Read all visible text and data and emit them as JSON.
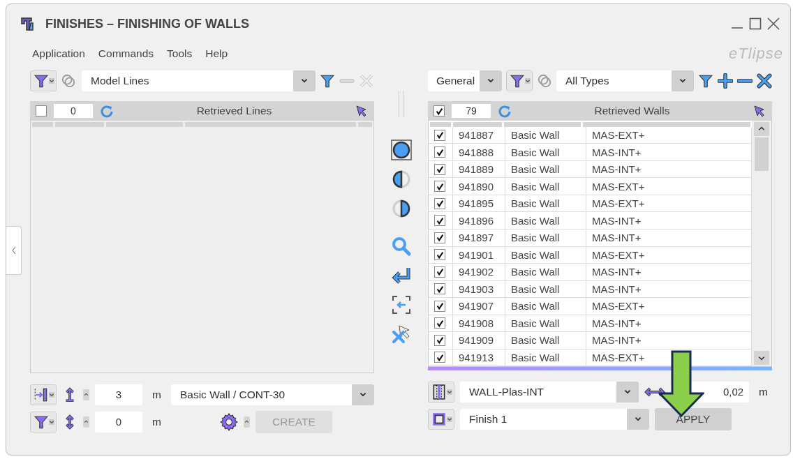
{
  "window": {
    "title": "FINISHES – FINISHING OF WALLS",
    "brand": "eTlipse"
  },
  "menu": [
    "Application",
    "Commands",
    "Tools",
    "Help"
  ],
  "left_panel": {
    "filter": "Model Lines",
    "grid": {
      "all_checked": false,
      "count": "0",
      "title": "Retrieved Lines"
    },
    "height": {
      "value": "3",
      "unit": "m"
    },
    "wall_type": "Basic Wall / CONT-30",
    "offset": {
      "value": "0",
      "unit": "m"
    },
    "create": {
      "label": "CREATE",
      "disabled": true
    }
  },
  "right_panel": {
    "category": "General",
    "filter": "All Types",
    "grid": {
      "all_checked": true,
      "count": "79",
      "title": "Retrieved Walls",
      "rows": [
        {
          "checked": true,
          "id": "941887",
          "family": "Basic Wall",
          "type": "MAS-EXT+"
        },
        {
          "checked": true,
          "id": "941888",
          "family": "Basic Wall",
          "type": "MAS-INT+"
        },
        {
          "checked": true,
          "id": "941889",
          "family": "Basic Wall",
          "type": "MAS-INT+"
        },
        {
          "checked": true,
          "id": "941890",
          "family": "Basic Wall",
          "type": "MAS-EXT+"
        },
        {
          "checked": true,
          "id": "941895",
          "family": "Basic Wall",
          "type": "MAS-EXT+"
        },
        {
          "checked": true,
          "id": "941896",
          "family": "Basic Wall",
          "type": "MAS-INT+"
        },
        {
          "checked": true,
          "id": "941897",
          "family": "Basic Wall",
          "type": "MAS-INT+"
        },
        {
          "checked": true,
          "id": "941901",
          "family": "Basic Wall",
          "type": "MAS-EXT+"
        },
        {
          "checked": true,
          "id": "941902",
          "family": "Basic Wall",
          "type": "MAS-INT+"
        },
        {
          "checked": true,
          "id": "941903",
          "family": "Basic Wall",
          "type": "MAS-INT+"
        },
        {
          "checked": true,
          "id": "941907",
          "family": "Basic Wall",
          "type": "MAS-EXT+"
        },
        {
          "checked": true,
          "id": "941908",
          "family": "Basic Wall",
          "type": "MAS-INT+"
        },
        {
          "checked": true,
          "id": "941909",
          "family": "Basic Wall",
          "type": "MAS-INT+"
        },
        {
          "checked": true,
          "id": "941913",
          "family": "Basic Wall",
          "type": "MAS-EXT+"
        }
      ]
    },
    "layer": "WALL-Plas-INT",
    "thickness": {
      "value": "0,02",
      "unit": "m"
    },
    "finish": "Finish 1",
    "apply": {
      "label": "APPLY",
      "disabled": false
    }
  }
}
